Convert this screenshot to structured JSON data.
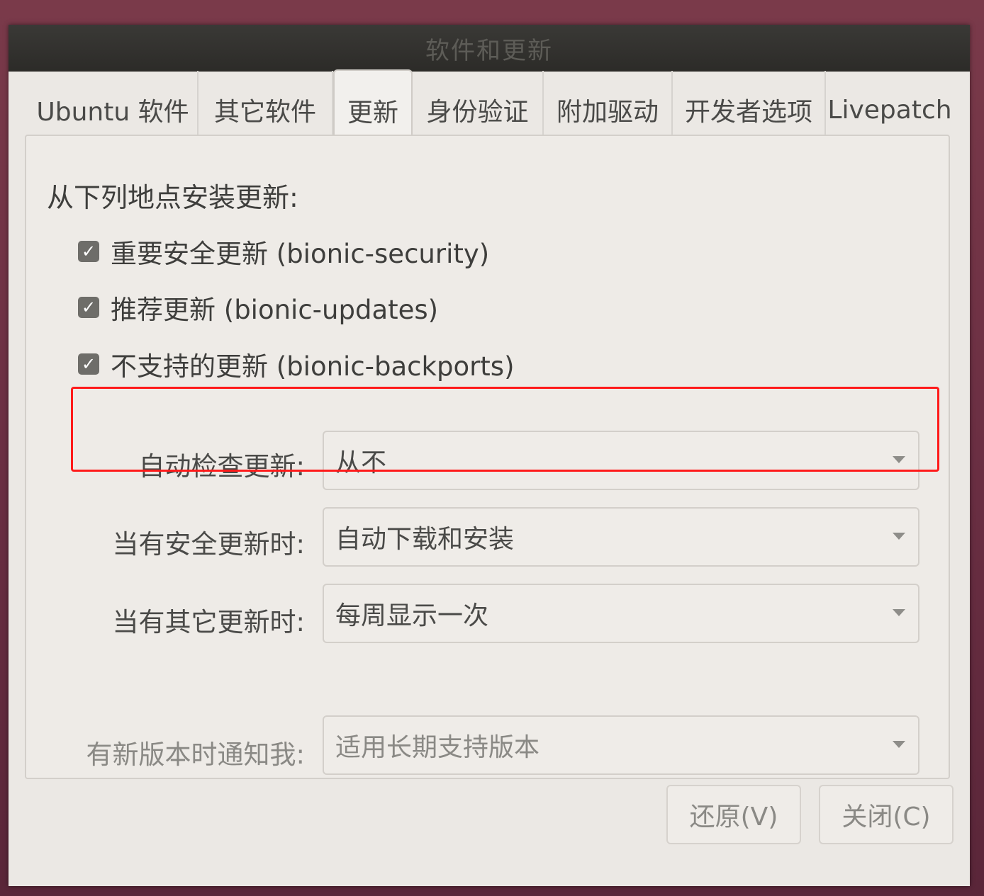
{
  "window": {
    "title": "软件和更新"
  },
  "tabs": [
    {
      "label": "Ubuntu 软件",
      "active": false
    },
    {
      "label": "其它软件",
      "active": false
    },
    {
      "label": "更新",
      "active": true
    },
    {
      "label": "身份验证",
      "active": false
    },
    {
      "label": "附加驱动",
      "active": false
    },
    {
      "label": "开发者选项",
      "active": false
    },
    {
      "label": "Livepatch",
      "active": false
    }
  ],
  "updates": {
    "heading": "从下列地点安装更新:",
    "sources": [
      {
        "label": "重要安全更新 (bionic-security)",
        "checked": true
      },
      {
        "label": "推荐更新 (bionic-updates)",
        "checked": true
      },
      {
        "label": "不支持的更新 (bionic-backports)",
        "checked": true
      }
    ],
    "auto_check": {
      "label": "自动检查更新:",
      "value": "从不"
    },
    "security_updates": {
      "label": "当有安全更新时:",
      "value": "自动下载和安装"
    },
    "other_updates": {
      "label": "当有其它更新时:",
      "value": "每周显示一次"
    },
    "new_version": {
      "label": "有新版本时通知我:",
      "value": "适用长期支持版本"
    }
  },
  "buttons": {
    "revert": "还原(V)",
    "close": "关闭(C)"
  },
  "colors": {
    "highlight": "#ff1a1a",
    "checkbox": "#6e6d69",
    "titlebar": "#2c2b28"
  }
}
